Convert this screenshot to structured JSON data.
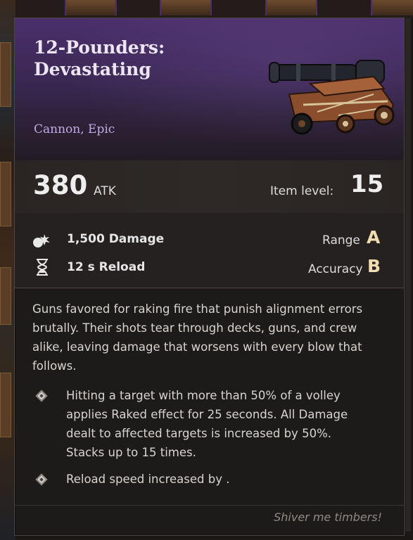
{
  "item": {
    "title": "12-Pounders: Devastating",
    "subtitle": "Cannon, Epic",
    "image_icon": "cannon-icon",
    "rarity_color": "#4a2f6a"
  },
  "stats": {
    "atk_value": "380",
    "atk_label": "ATK",
    "item_level_label": "Item level:",
    "item_level_value": "15"
  },
  "details": {
    "damage": "1,500 Damage",
    "damage_icon": "explosion-icon",
    "reload": "12 s Reload",
    "reload_icon": "hourglass-icon",
    "range_label": "Range",
    "range_grade": "A",
    "accuracy_label": "Accuracy",
    "accuracy_grade": "B"
  },
  "description": "Guns favored for raking fire that punish alignment errors brutally. Their shots tear through decks, guns, and crew alike, leaving damage that worsens with every blow that follows.",
  "perks": [
    "Hitting a target with more than 50% of a volley applies Raked effect for 25 seconds. All Damage dealt to affected targets is increased by 50%. Stacks up to 15 times.",
    "Reload speed increased by ."
  ],
  "flavor_text": "Shiver me timbers!"
}
